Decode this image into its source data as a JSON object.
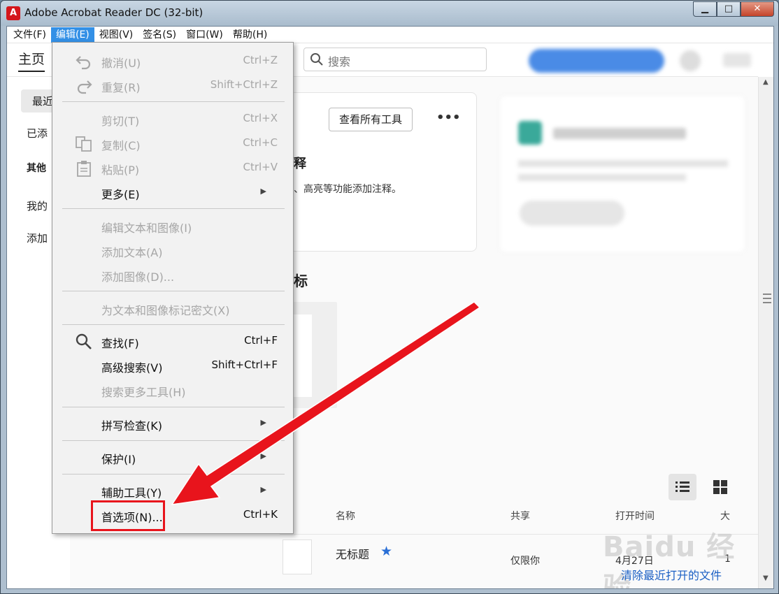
{
  "window": {
    "title": "Adobe Acrobat Reader DC (32-bit)",
    "logo_glyph": "A"
  },
  "menubar": [
    {
      "label": "文件(F)"
    },
    {
      "label": "编辑(E)",
      "active": true
    },
    {
      "label": "视图(V)"
    },
    {
      "label": "签名(S)"
    },
    {
      "label": "窗口(W)"
    },
    {
      "label": "帮助(H)"
    }
  ],
  "topbar": {
    "home_tab": "主页",
    "search_placeholder": "搜索"
  },
  "sidebar": {
    "items": [
      "最近",
      "已添",
      "其他",
      "我的",
      "添加"
    ]
  },
  "tools_card": {
    "view_all_tools": "查看所有工具",
    "more": "•••",
    "heading_fragment": "释",
    "desc_fragment": "、高亮等功能添加注释。"
  },
  "section_fragment": "标",
  "file_list": {
    "col_name": "名称",
    "col_shared": "共享",
    "col_opened": "打开时间",
    "col_size": "大",
    "rows": [
      {
        "name": "无标题",
        "shared": "仅限你",
        "opened": "4月27日",
        "size": "1"
      }
    ],
    "clear_recent": "清除最近打开的文件"
  },
  "watermark": "Baidu 经验",
  "edit_menu": {
    "items": [
      {
        "label": "撤消(U)",
        "shortcut": "Ctrl+Z",
        "disabled": true,
        "icon": "undo-icon"
      },
      {
        "label": "重复(R)",
        "shortcut": "Shift+Ctrl+Z",
        "disabled": true,
        "icon": "redo-icon"
      },
      {
        "label": "剪切(T)",
        "shortcut": "Ctrl+X",
        "disabled": true
      },
      {
        "label": "复制(C)",
        "shortcut": "Ctrl+C",
        "disabled": true,
        "icon": "copy-icon"
      },
      {
        "label": "粘贴(P)",
        "shortcut": "Ctrl+V",
        "disabled": true,
        "icon": "paste-icon"
      },
      {
        "label": "更多(E)",
        "submenu": true
      },
      {
        "label": "编辑文本和图像(I)",
        "disabled": true
      },
      {
        "label": "添加文本(A)",
        "disabled": true
      },
      {
        "label": "添加图像(D)...",
        "disabled": true
      },
      {
        "label": "为文本和图像标记密文(X)",
        "disabled": true
      },
      {
        "label": "查找(F)",
        "shortcut": "Ctrl+F",
        "icon": "search-icon"
      },
      {
        "label": "高级搜索(V)",
        "shortcut": "Shift+Ctrl+F"
      },
      {
        "label": "搜索更多工具(H)",
        "disabled": true
      },
      {
        "label": "拼写检查(K)",
        "submenu": true
      },
      {
        "label": "保护(I)",
        "submenu": true
      },
      {
        "label": "辅助工具(Y)",
        "submenu": true
      },
      {
        "label": "首选项(N)...",
        "shortcut": "Ctrl+K"
      }
    ]
  },
  "colors": {
    "accent": "#3390e6",
    "highlight": "#e8141c",
    "link": "#1a5fc4"
  }
}
